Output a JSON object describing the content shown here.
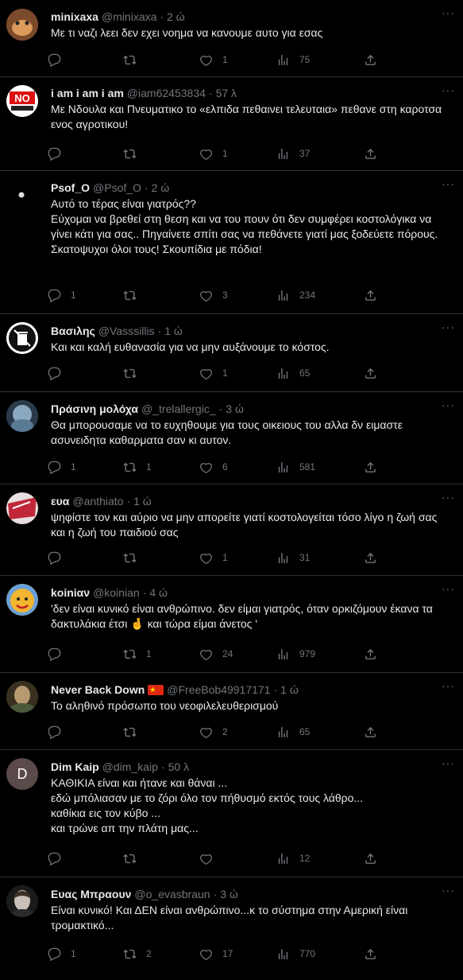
{
  "tweets": [
    {
      "name": "minixaxa",
      "handle": "@minixaxa",
      "time": "2 ώ",
      "text": "Με τι ναζι λεει δεν εχει νοημα να κανουμε αυτο για εσας",
      "replies": "",
      "retweets": "",
      "likes": "1",
      "views": "75",
      "avatar_color": "#b86a3c"
    },
    {
      "name": "i am i am i am",
      "handle": "@iam62453834",
      "time": "57 λ",
      "text": "Με Νδουλα και Πνευματικο  το «ελπιδα πεθαινει τελευταια» πεθανε στη καροτσα ενος αγροτικου!",
      "replies": "",
      "retweets": "",
      "likes": "1",
      "views": "37",
      "avatar_color": "#ffffff",
      "avatar_text": "NO"
    },
    {
      "name": "Psof_O",
      "handle": "@Psof_O",
      "time": "2 ώ",
      "text": "Αυτό το τέρας είναι γιατρός??\nΕύχομαι να βρεθεί στη θεση και να του πουν ότι δεν συμφέρει κοστολόγικα να γίνει κάτι για σας.. Πηγαίνετε σπίτι σας να πεθάνετε γιατί μας ξοδεύετε πόρους.\nΣκατοψυχοι όλοι τους! Σκουπίδια με πόδια!",
      "replies": "1",
      "retweets": "",
      "likes": "3",
      "views": "234",
      "avatar_color": "#000000"
    },
    {
      "name": "Βασιλης",
      "handle": "@Vasssillis",
      "time": "1 ώ",
      "text": "Και και καλή ευθανασία  για να μην αυξάνουμε το κόστος.",
      "replies": "",
      "retweets": "",
      "likes": "1",
      "views": "65",
      "avatar_color": "#ffffff"
    },
    {
      "name": "Πράσινη μολόχα",
      "handle": "@_trelallergic_",
      "time": "3 ώ",
      "text": "Θα μπορουσαμε να το ευχηθουμε για τους οικειους του αλλα δν ειμαστε ασυνειδητα καθαρματα σαν κι αυτον.",
      "replies": "1",
      "retweets": "1",
      "likes": "6",
      "views": "581",
      "avatar_color": "#4a6a8a"
    },
    {
      "name": "ευα",
      "handle": "@anthiato",
      "time": "1 ώ",
      "text": "ψηφίστε τον και αύριο να μην απορείτε γιατί κοστολογείται τόσο λίγο η ζωή σας και η ζωή του παιδιού σας",
      "replies": "",
      "retweets": "",
      "likes": "1",
      "views": "31",
      "avatar_color": "#c0283a"
    },
    {
      "name": "koiniαν",
      "handle": "@koinian",
      "time": "4 ώ",
      "text": "'δεν είναι κυνικό είναι ανθρώπινο. δεν είμαι γιατρός,  όταν ορκιζόμουν έκανα τα δακτυλάκια έτσι 🤞 και τώρα είμαι άνετος '",
      "replies": "",
      "retweets": "1",
      "likes": "24",
      "views": "979",
      "avatar_color": "#f2b630"
    },
    {
      "name": "Never Back Down",
      "handle": "@FreeBob49917171",
      "time": "1 ώ",
      "text": "Το αληθινό πρόσωπο του νεοφιλελευθερισμού",
      "replies": "",
      "retweets": "",
      "likes": "2",
      "views": "65",
      "avatar_color": "#6b5a3a",
      "flag": true
    },
    {
      "name": "Dim Kaip",
      "handle": "@dim_kaip",
      "time": "50 λ",
      "text": "ΚΑΘΙΚΙΑ είναι και ήτανε και θάναι ...\nεδώ μπόλιασαν με το ζόρι όλο τον πήθυσμό εκτός τους λάθρο...\nκαθίκια εις τον κύβο ...\nκαι τρώνε απ την πλάτη μας...",
      "replies": "",
      "retweets": "",
      "likes": "",
      "views": "12",
      "avatar_color": "#5b4a4a",
      "avatar_text": "D"
    },
    {
      "name": "Ευας Μπραουν",
      "handle": "@o_evasbraun",
      "time": "3 ώ",
      "text": "Είναι κυνικό! Και ΔΕΝ είναι ανθρώπινο...κ το σύστημα στην Αμερική είναι τρομακτικό...",
      "replies": "1",
      "retweets": "2",
      "likes": "17",
      "views": "770",
      "avatar_color": "#3a3a3a"
    }
  ],
  "icons": {
    "more": "more-icon",
    "reply": "reply-icon",
    "retweet": "retweet-icon",
    "like": "heart-icon",
    "views": "views-icon",
    "share": "share-icon"
  },
  "more_label": "···"
}
